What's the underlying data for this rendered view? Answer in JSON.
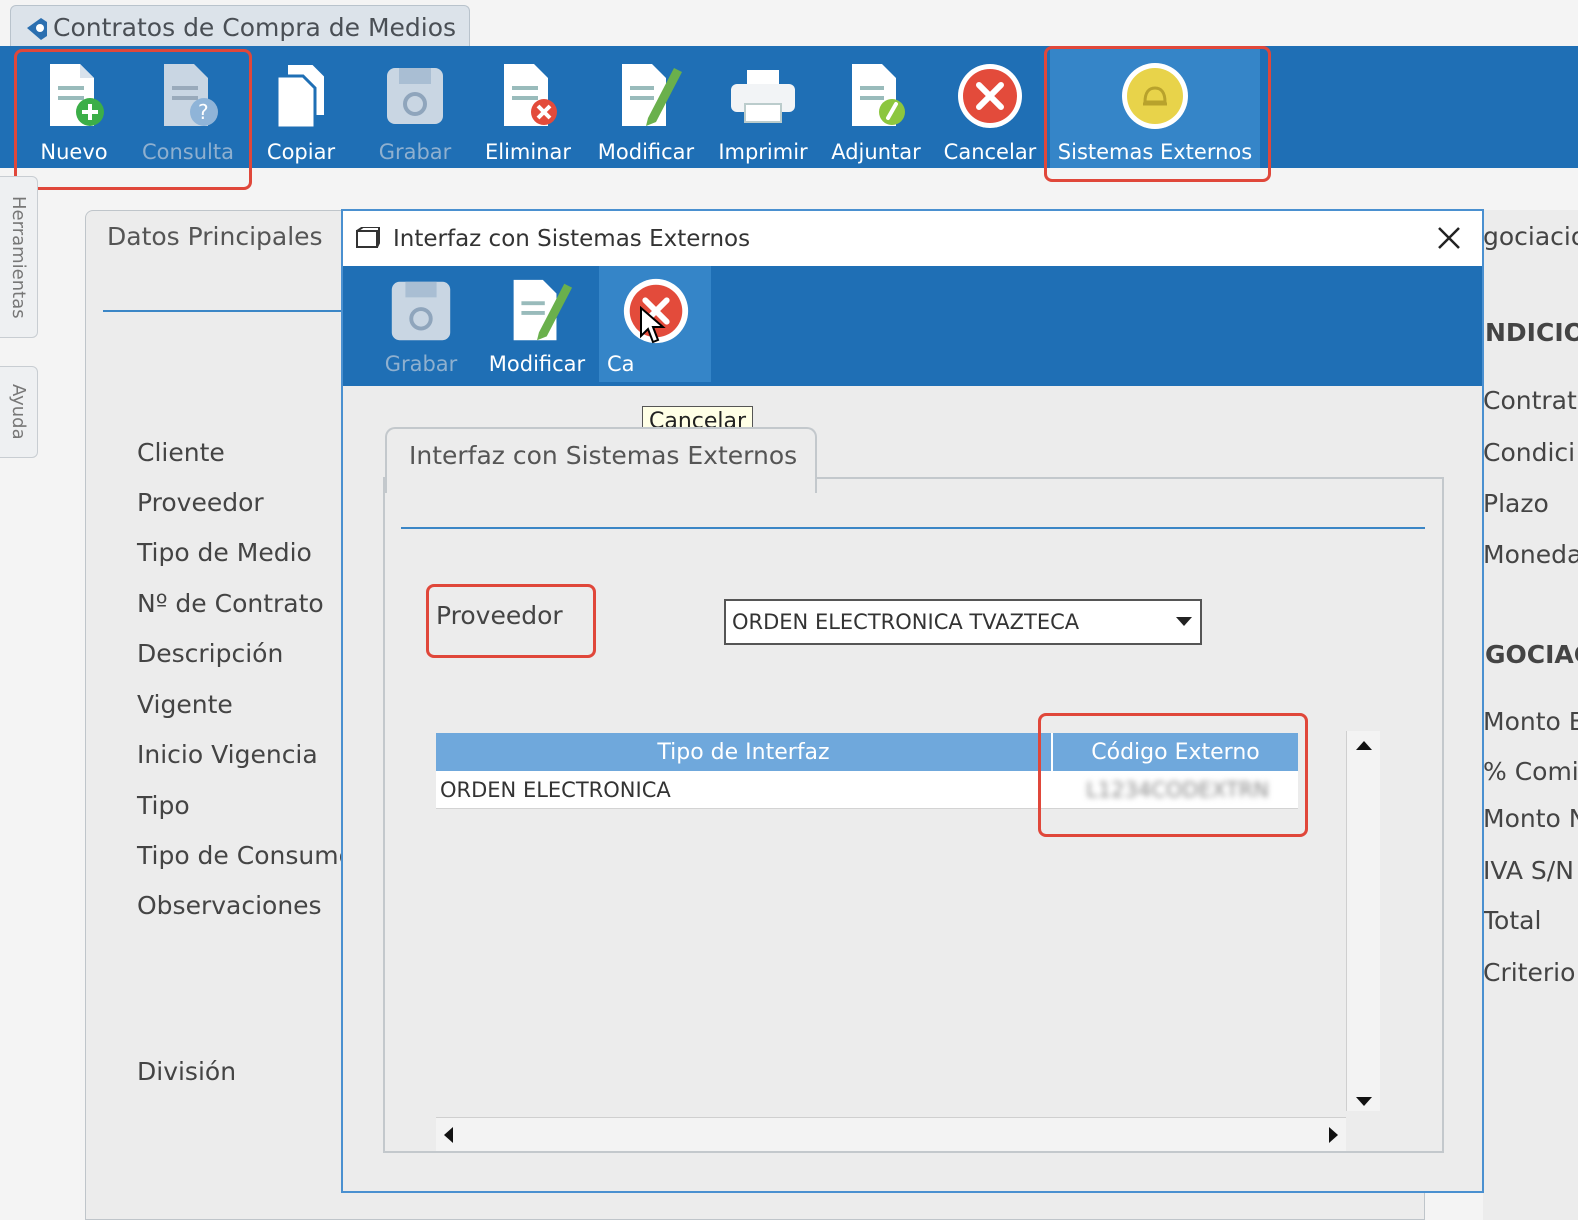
{
  "app": {
    "tab_title": "Contratos de Compra de Medios",
    "toolbar": [
      {
        "label": "Nuevo",
        "icon": "doc-add-icon",
        "disabled": false
      },
      {
        "label": "Consulta",
        "icon": "doc-query-icon",
        "disabled": true
      },
      {
        "label": "Copiar",
        "icon": "copy-icon",
        "disabled": false
      },
      {
        "label": "Grabar",
        "icon": "save-icon",
        "disabled": true
      },
      {
        "label": "Eliminar",
        "icon": "doc-delete-icon",
        "disabled": false
      },
      {
        "label": "Modificar",
        "icon": "doc-edit-icon",
        "disabled": false
      },
      {
        "label": "Imprimir",
        "icon": "printer-icon",
        "disabled": false
      },
      {
        "label": "Adjuntar",
        "icon": "attach-icon",
        "disabled": false
      },
      {
        "label": "Cancelar",
        "icon": "cancel-icon",
        "disabled": false
      },
      {
        "label": "Sistemas Externos",
        "icon": "external-systems-icon",
        "disabled": false
      }
    ],
    "side_tabs": [
      "Herramientas",
      "Ayuda"
    ]
  },
  "main": {
    "tab_label": "Datos Principales",
    "fields": [
      "Cliente",
      "Proveedor",
      "Tipo de Medio",
      "Nº de Contrato",
      "Descripción",
      "Vigente",
      "Inicio Vigencia",
      "Tipo",
      "Tipo de Consumo",
      "Observaciones",
      "División"
    ],
    "right_partial": {
      "tab": "gociacio",
      "section1": "NDICIO",
      "items1": [
        "Contrato",
        "Condici",
        "Plazo",
        "Moneda"
      ],
      "section2": "GOCIAC",
      "items2": [
        "Monto B",
        "% Comis",
        "Monto N",
        "IVA S/N",
        "Total",
        "Criterio"
      ]
    }
  },
  "dialog": {
    "title": "Interfaz con Sistemas Externos",
    "toolbar": [
      {
        "label": "Grabar",
        "icon": "save-icon",
        "disabled": true
      },
      {
        "label": "Modificar",
        "icon": "doc-edit-icon",
        "disabled": false
      },
      {
        "label": "Ca",
        "icon": "cancel-icon",
        "disabled": false
      }
    ],
    "tooltip": "Cancelar",
    "tab_label": "Interfaz con Sistemas Externos",
    "proveedor_label": "Proveedor",
    "proveedor_value": "ORDEN ELECTRONICA TVAZTECA",
    "grid": {
      "columns": [
        "Tipo de Interfaz",
        "Código Externo"
      ],
      "rows": [
        [
          "ORDEN ELECTRONICA",
          "L1234CODEXTRN"
        ]
      ]
    }
  },
  "colors": {
    "toolbar_blue": "#1f6fb5",
    "highlight_red": "#e0473a",
    "grid_header": "#6fa8dc"
  }
}
